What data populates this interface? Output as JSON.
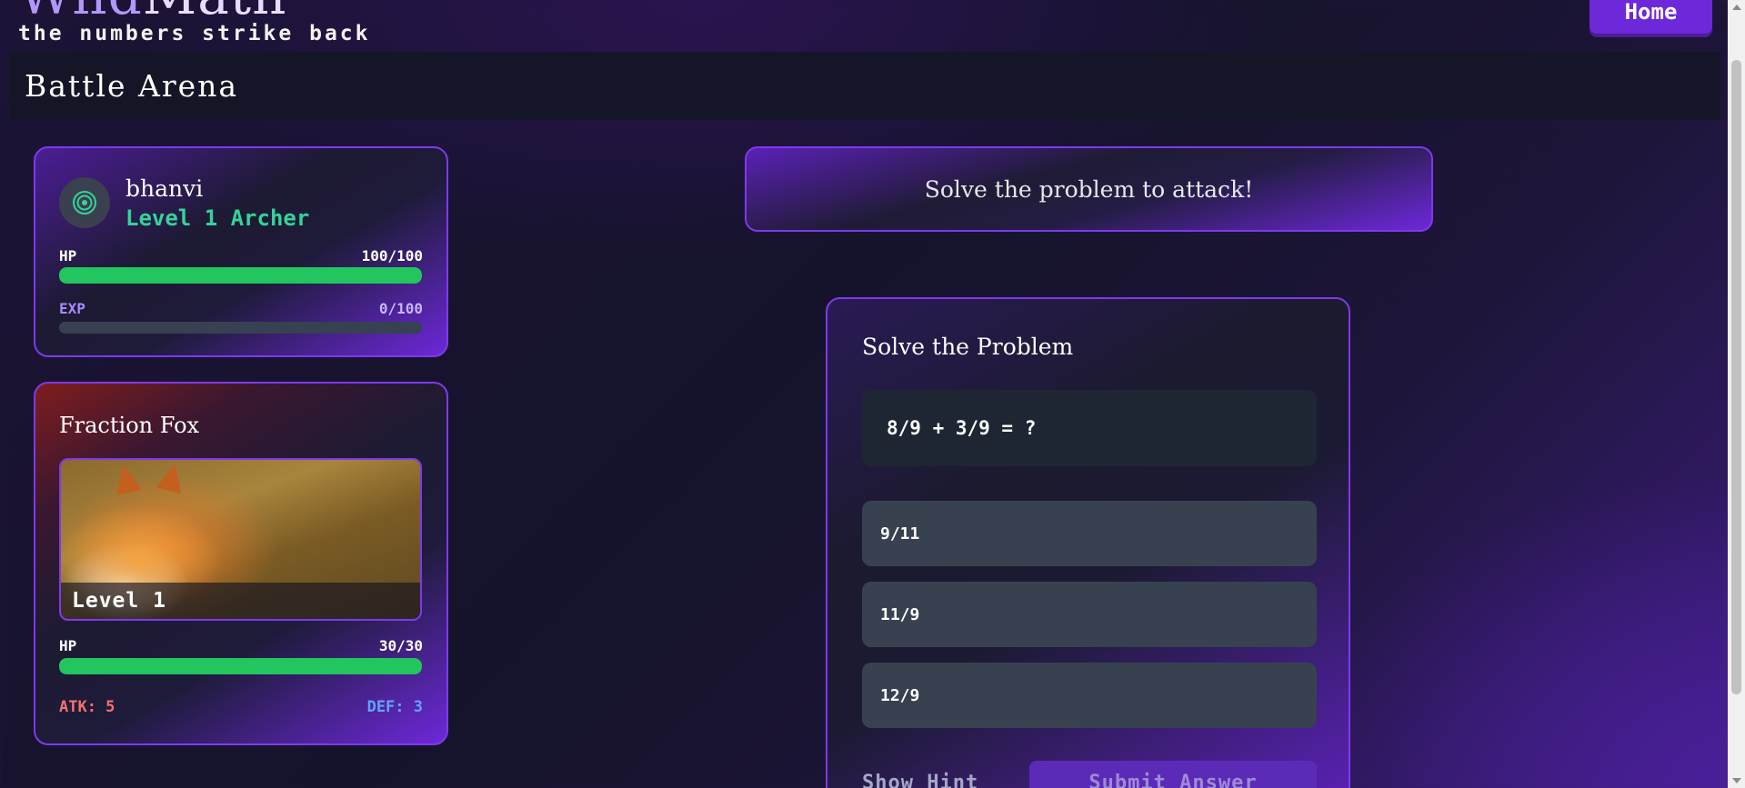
{
  "header": {
    "logo_part1": "Wild",
    "logo_part2": "Math",
    "tagline": "the numbers strike back",
    "home_label": "Home",
    "section_title": "Battle Arena"
  },
  "player": {
    "name": "bhanvi",
    "level_label": "Level 1 Archer",
    "avatar_icon": "target-icon",
    "hp_label": "HP",
    "hp_value": "100/100",
    "hp_fraction": 1.0,
    "exp_label": "EXP",
    "exp_value": "0/100",
    "exp_fraction": 0.0
  },
  "monster": {
    "name": "Fraction Fox",
    "image_icon": "fox-photo",
    "level_label": "Level 1",
    "hp_label": "HP",
    "hp_value": "30/30",
    "hp_fraction": 1.0,
    "atk_label": "ATK: 5",
    "def_label": "DEF: 3"
  },
  "battle": {
    "prompt": "Solve the problem to attack!"
  },
  "problem": {
    "title": "Solve the Problem",
    "equation": "8/9 + 3/9 = ?",
    "options": [
      "9/11",
      "11/9",
      "12/9"
    ],
    "hint_label": "Show Hint",
    "submit_label": "Submit Answer"
  },
  "colors": {
    "accent": "#7c3aed",
    "hp_green": "#22c55e",
    "level_green": "#34d399",
    "atk_red": "#f87171",
    "def_blue": "#60a5fa"
  }
}
